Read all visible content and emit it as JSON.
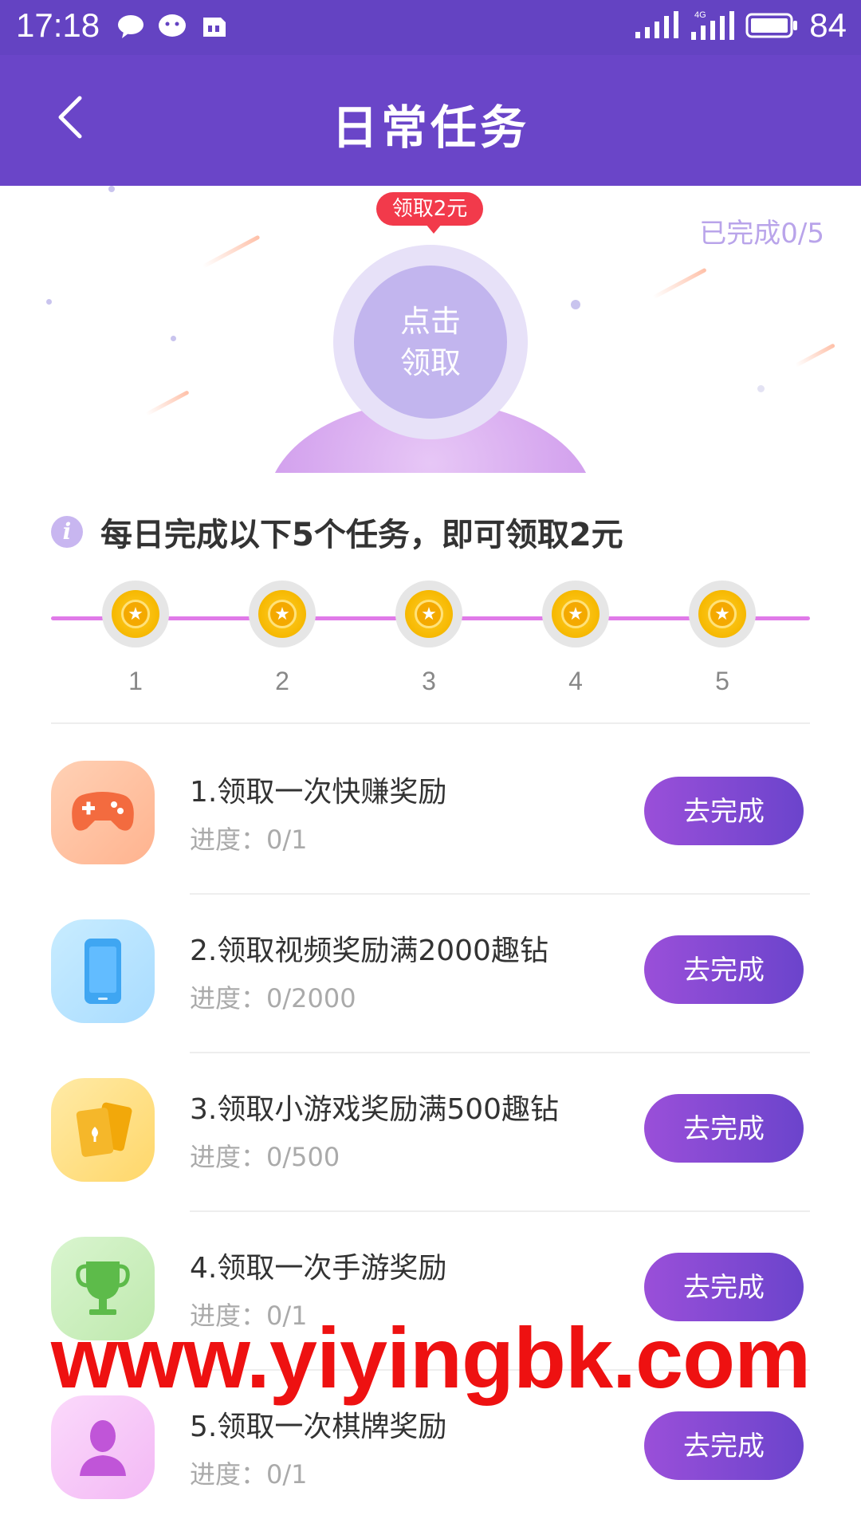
{
  "status_bar": {
    "time": "17:18",
    "battery": "84",
    "network": "4G"
  },
  "header": {
    "title": "日常任务"
  },
  "hero": {
    "badge": "领取2元",
    "done_count": "已完成0/5",
    "orb_line1": "点击",
    "orb_line2": "领取"
  },
  "info": {
    "text": "每日完成以下5个任务，即可领取2元"
  },
  "progress": {
    "steps": [
      "1",
      "2",
      "3",
      "4",
      "5"
    ],
    "completed": 0,
    "total": 5
  },
  "tasks": [
    {
      "name": "1.领取一次快赚奖励",
      "progress": "进度：0/1",
      "button": "去完成",
      "icon": "gamepad-icon"
    },
    {
      "name": "2.领取视频奖励满2000趣钻",
      "progress": "进度：0/2000",
      "button": "去完成",
      "icon": "phone-icon"
    },
    {
      "name": "3.领取小游戏奖励满500趣钻",
      "progress": "进度：0/500",
      "button": "去完成",
      "icon": "cards-icon"
    },
    {
      "name": "4.领取一次手游奖励",
      "progress": "进度：0/1",
      "button": "去完成",
      "icon": "trophy-icon"
    },
    {
      "name": "5.领取一次棋牌奖励",
      "progress": "进度：0/1",
      "button": "去完成",
      "icon": "person-icon"
    }
  ],
  "watermark": "www.yiyingbk.com",
  "colors": {
    "primary": "#6a45c8",
    "badge_red": "#f23a4b",
    "line_pink": "#e07ae8",
    "watermark_red": "#ee1111"
  }
}
